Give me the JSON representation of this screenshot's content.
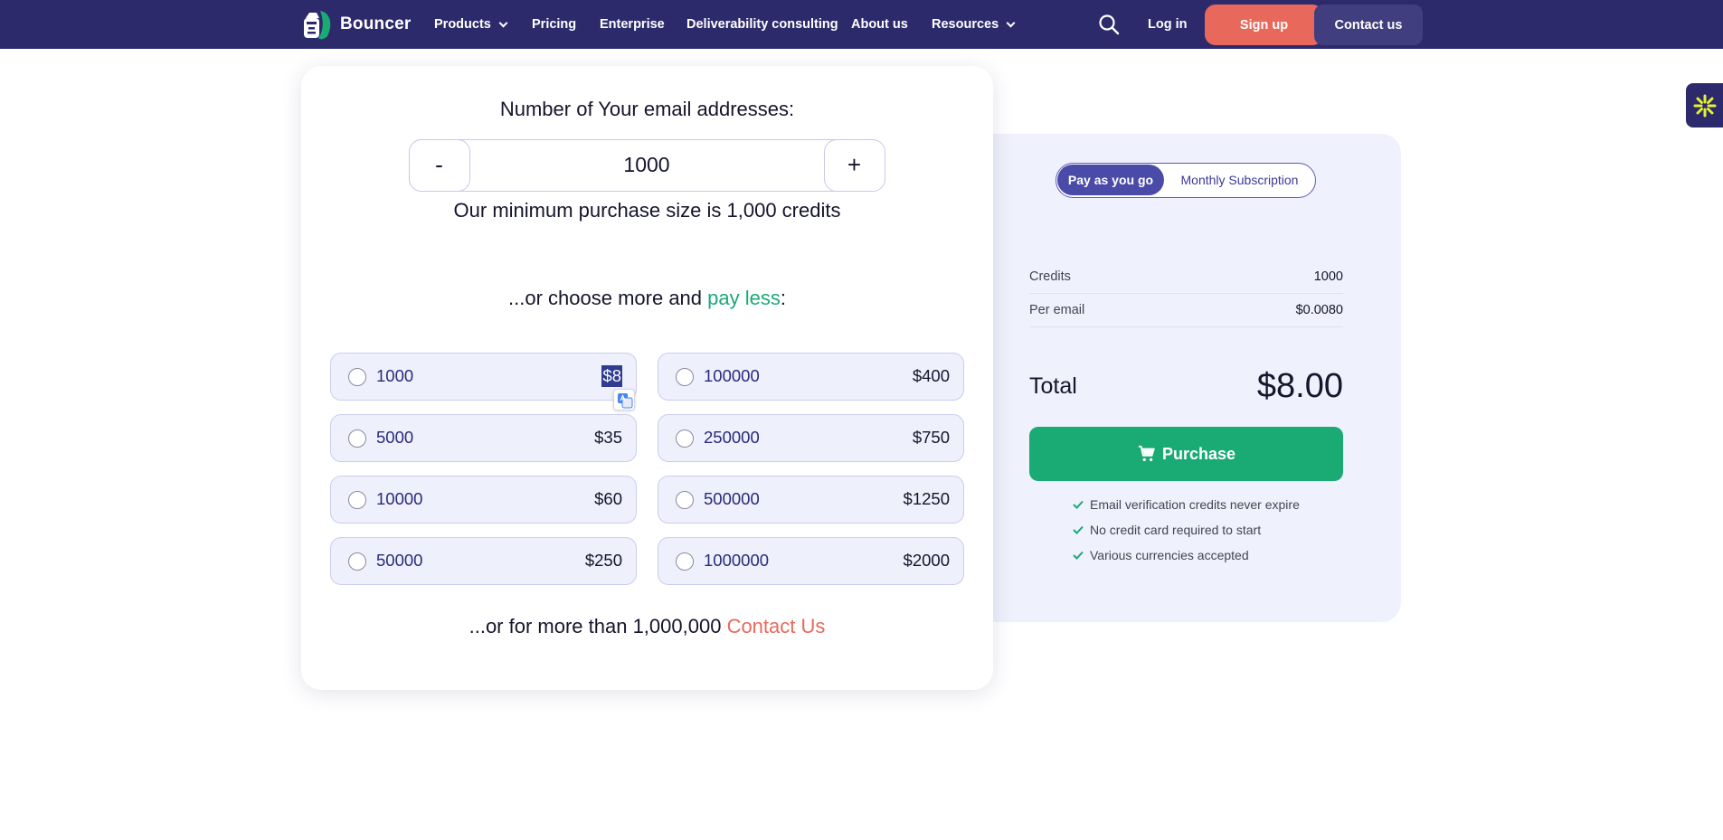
{
  "nav": {
    "brand": "Bouncer",
    "items": [
      {
        "label": "Products",
        "has_dropdown": true
      },
      {
        "label": "Pricing",
        "has_dropdown": false
      },
      {
        "label": "Enterprise",
        "has_dropdown": false
      },
      {
        "label": "Deliverability consulting",
        "has_dropdown": false
      },
      {
        "label": "About us",
        "has_dropdown": false
      },
      {
        "label": "Resources",
        "has_dropdown": true
      }
    ],
    "search_icon": "search-icon",
    "login": "Log in",
    "signup": "Sign up",
    "contact": "Contact us"
  },
  "calculator": {
    "title": "Number of Your email addresses:",
    "minus": "-",
    "plus": "+",
    "value": "1000",
    "min_note": "Our minimum purchase size is 1,000 credits",
    "choose_prefix": "...or choose more and ",
    "choose_highlight": "pay less",
    "choose_suffix": ":",
    "options": [
      {
        "qty": "1000",
        "price": "$8"
      },
      {
        "qty": "100000",
        "price": "$400"
      },
      {
        "qty": "5000",
        "price": "$35"
      },
      {
        "qty": "250000",
        "price": "$750"
      },
      {
        "qty": "10000",
        "price": "$60"
      },
      {
        "qty": "500000",
        "price": "$1250"
      },
      {
        "qty": "50000",
        "price": "$250"
      },
      {
        "qty": "1000000",
        "price": "$2000"
      }
    ],
    "more_prefix": "...or for more than 1,000,000 ",
    "more_link": "Contact Us"
  },
  "summary": {
    "toggle_active": "Pay as you go",
    "toggle_inactive": "Monthly Subscription",
    "rows": [
      {
        "label": "Credits",
        "value": "1000"
      },
      {
        "label": "Per email",
        "value": "$0.0080"
      }
    ],
    "total_label": "Total",
    "total_value": "$8.00",
    "purchase": "Purchase",
    "features": [
      "Email verification credits never expire",
      "No credit card required to start",
      "Various currencies accepted"
    ]
  },
  "colors": {
    "nav_bg": "#2c2a6b",
    "accent_orange": "#e8695b",
    "accent_green": "#1aaa74",
    "panel_bg": "#eff1fc"
  }
}
